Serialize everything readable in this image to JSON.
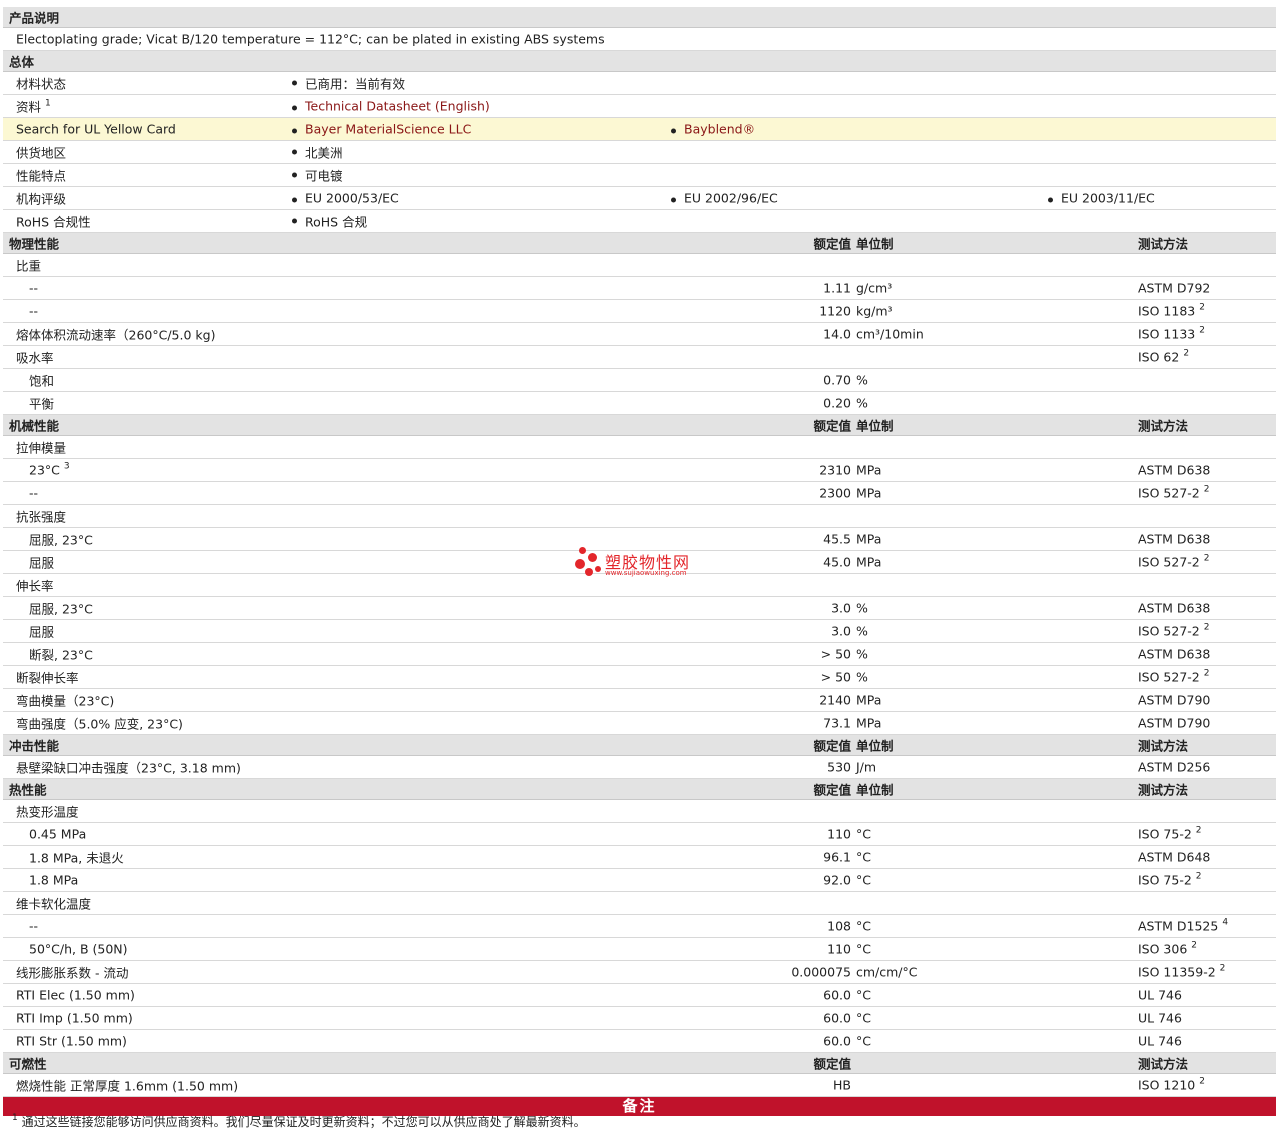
{
  "desc": {
    "title": "产品说明",
    "text": "Electoplating grade; Vicat B/120 temperature = 112°C; can be plated in existing ABS systems"
  },
  "general": {
    "title": "总体",
    "status_label": "材料状态",
    "status_value": "已商用：当前有效",
    "docs_label": "资料",
    "docs_sup": "1",
    "docs_link": "Technical Datasheet (English)",
    "ul_label": "Search for UL Yellow Card",
    "ul_link1": "Bayer MaterialScience LLC",
    "ul_link2": "Bayblend®",
    "region_label": "供货地区",
    "region_value": "北美洲",
    "feature_label": "性能特点",
    "feature_value": "可电镀",
    "agency_label": "机构评级",
    "agency1": "EU 2000/53/EC",
    "agency2": "EU 2002/96/EC",
    "agency3": "EU 2003/11/EC",
    "rohs_label": "RoHS 合规性",
    "rohs_value": "RoHS 合规"
  },
  "headers": {
    "rated": "额定值",
    "unit": "单位制",
    "method": "测试方法"
  },
  "physical": {
    "title": "物理性能",
    "sg_label": "比重",
    "sg1_label": "--",
    "sg1_val": "1.11",
    "sg1_unit": "g/cm³",
    "sg1_method": "ASTM D792",
    "sg2_label": "--",
    "sg2_val": "1120",
    "sg2_unit": "kg/m³",
    "sg2_method": "ISO 1183",
    "sg2_sup": "2",
    "mvr_label": "熔体体积流动速率（260°C/5.0 kg)",
    "mvr_val": "14.0",
    "mvr_unit": "cm³/10min",
    "mvr_method": "ISO 1133",
    "mvr_sup": "2",
    "wa_label": "吸水率",
    "wa_method": "ISO 62",
    "wa_sup": "2",
    "wa1_label": "饱和",
    "wa1_val": "0.70",
    "wa1_unit": "%",
    "wa2_label": "平衡",
    "wa2_val": "0.20",
    "wa2_unit": "%"
  },
  "mechanical": {
    "title": "机械性能",
    "tm_label": "拉伸模量",
    "tm1_label": "23°C",
    "tm1_sup": "3",
    "tm1_val": "2310",
    "tm1_unit": "MPa",
    "tm1_method": "ASTM D638",
    "tm2_label": "--",
    "tm2_val": "2300",
    "tm2_unit": "MPa",
    "tm2_method": "ISO 527-2",
    "tm2_sup": "2",
    "ts_label": "抗张强度",
    "ts1_label": "屈服, 23°C",
    "ts1_val": "45.5",
    "ts1_unit": "MPa",
    "ts1_method": "ASTM D638",
    "ts2_label": "屈服",
    "ts2_val": "45.0",
    "ts2_unit": "MPa",
    "ts2_method": "ISO 527-2",
    "ts2_sup": "2",
    "el_label": "伸长率",
    "el1_label": "屈服, 23°C",
    "el1_val": "3.0",
    "el1_unit": "%",
    "el1_method": "ASTM D638",
    "el2_label": "屈服",
    "el2_val": "3.0",
    "el2_unit": "%",
    "el2_method": "ISO 527-2",
    "el2_sup": "2",
    "el3_label": "断裂, 23°C",
    "el3_val": "> 50",
    "el3_unit": "%",
    "el3_method": "ASTM D638",
    "eb_label": "断裂伸长率",
    "eb_val": "> 50",
    "eb_unit": "%",
    "eb_method": "ISO 527-2",
    "eb_sup": "2",
    "fm_label": "弯曲模量（23°C)",
    "fm_val": "2140",
    "fm_unit": "MPa",
    "fm_method": "ASTM D790",
    "fs_label": "弯曲强度（5.0% 应变, 23°C)",
    "fs_val": "73.1",
    "fs_unit": "MPa",
    "fs_method": "ASTM D790"
  },
  "impact": {
    "title": "冲击性能",
    "izod_label": "悬壁梁缺口冲击强度（23°C, 3.18 mm)",
    "izod_val": "530",
    "izod_unit": "J/m",
    "izod_method": "ASTM D256"
  },
  "thermal": {
    "title": "热性能",
    "hdt_label": "热变形温度",
    "hdt1_label": "0.45 MPa",
    "hdt1_val": "110",
    "hdt1_unit": "°C",
    "hdt1_method": "ISO 75-2",
    "hdt1_sup": "2",
    "hdt2_label": "1.8 MPa, 未退火",
    "hdt2_val": "96.1",
    "hdt2_unit": "°C",
    "hdt2_method": "ASTM D648",
    "hdt3_label": "1.8 MPa",
    "hdt3_val": "92.0",
    "hdt3_unit": "°C",
    "hdt3_method": "ISO 75-2",
    "hdt3_sup": "2",
    "vicat_label": "维卡软化温度",
    "v1_label": "--",
    "v1_val": "108",
    "v1_unit": "°C",
    "v1_method": "ASTM D1525",
    "v1_sup": "4",
    "v2_label": "50°C/h, B (50N)",
    "v2_val": "110",
    "v2_unit": "°C",
    "v2_method": "ISO 306",
    "v2_sup": "2",
    "clte_label": "线形膨胀系数 - 流动",
    "clte_val": "0.000075",
    "clte_unit": "cm/cm/°C",
    "clte_method": "ISO 11359-2",
    "clte_sup": "2",
    "rti_elec_label": "RTI Elec (1.50 mm)",
    "rti_elec_val": "60.0",
    "rti_elec_unit": "°C",
    "rti_elec_method": "UL 746",
    "rti_imp_label": "RTI Imp (1.50 mm)",
    "rti_imp_val": "60.0",
    "rti_imp_unit": "°C",
    "rti_imp_method": "UL 746",
    "rti_str_label": "RTI Str (1.50 mm)",
    "rti_str_val": "60.0",
    "rti_str_unit": "°C",
    "rti_str_method": "UL 746"
  },
  "flammability": {
    "title": "可燃性",
    "rated": "额定值",
    "method": "测试方法",
    "fl_label": "燃烧性能 正常厚度 1.6mm (1.50 mm)",
    "fl_val": "HB",
    "fl_method": "ISO 1210",
    "fl_sup": "2"
  },
  "notes": {
    "title": "备注",
    "fn_sup": "1",
    "fn_text": "通过这些链接您能够访问供应商资料。我们尽量保证及时更新资料；不过您可以从供应商处了解最新资料。"
  },
  "watermark": {
    "name": "塑胶物性网",
    "url": "www.sujiaowuxing.com"
  }
}
